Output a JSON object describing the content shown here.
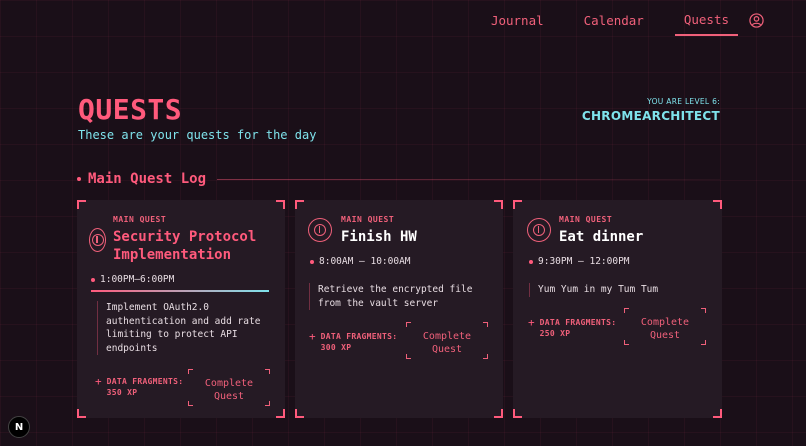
{
  "nav": {
    "items": [
      {
        "label": "Journal"
      },
      {
        "label": "Calendar"
      },
      {
        "label": "Quests"
      }
    ],
    "active": "Quests",
    "profile_icon": "user-circle-icon"
  },
  "header": {
    "title": "QUESTS",
    "subtitle": "These are your quests for the day",
    "level_label": "YOU ARE LEVEL 6:",
    "username": "CHROMEARCHITECT"
  },
  "section": {
    "title": "Main Quest Log"
  },
  "quests": [
    {
      "kind": "MAIN QUEST",
      "name_line1": "Security Protocol",
      "name_line2": "Implementation",
      "time": "1:00PM–6:00PM",
      "progress": 1.0,
      "description_lines": [
        "Implement OAuth2.0",
        "authentication and add rate",
        "limiting to protect API",
        "endpoints"
      ],
      "reward_line1": "DATA FRAGMENTS:",
      "reward_line2": "350 XP",
      "button_line1": "Complete",
      "button_line2": "Quest"
    },
    {
      "kind": "MAIN QUEST",
      "name_line1": "Finish HW",
      "time": "8:00AM – 10:00AM",
      "description_lines": [
        "Retrieve the encrypted file",
        "from the vault server"
      ],
      "reward_line1": "DATA FRAGMENTS:",
      "reward_line2": "300 XP",
      "button_line1": "Complete",
      "button_line2": "Quest"
    },
    {
      "kind": "MAIN QUEST",
      "name_line1": "Eat dinner",
      "time": "9:30PM – 12:00PM",
      "description_lines": [
        "Yum Yum in my Tum Tum"
      ],
      "reward_line1": "DATA FRAGMENTS:",
      "reward_line2": "250 XP",
      "button_line1": "Complete",
      "button_line2": "Quest"
    }
  ],
  "dev_badge": "N",
  "colors": {
    "accent": "#ff5a7c",
    "cyan": "#7fe3ec",
    "background": "#1a0f18",
    "card": "#251a24"
  }
}
